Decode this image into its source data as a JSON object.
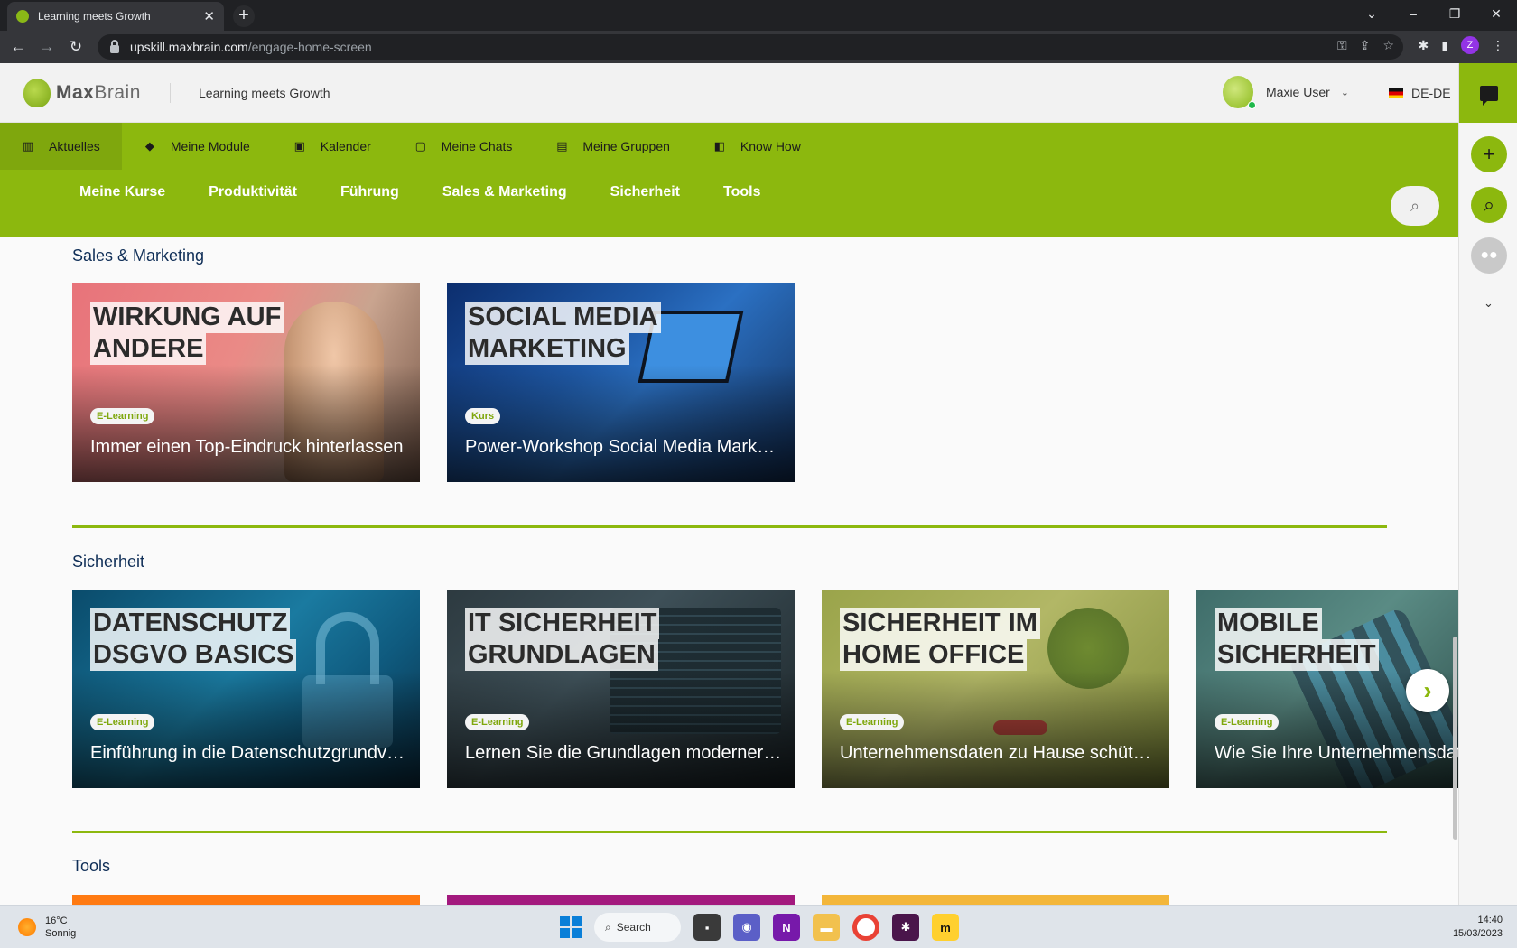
{
  "browser": {
    "tab_title": "Learning meets Growth",
    "new_tab_symbol": "+",
    "url_host": "upskill.maxbrain.com",
    "url_path": "/engage-home-screen",
    "profile_initial": "Z"
  },
  "header": {
    "logo_bold": "Max",
    "logo_light": "Brain",
    "tagline": "Learning meets Growth",
    "user_name": "Maxie User",
    "language": "DE-DE"
  },
  "primary_nav": [
    {
      "label": "Aktuelles",
      "icon": "library-icon"
    },
    {
      "label": "Meine Module",
      "icon": "graduation-cap-icon"
    },
    {
      "label": "Kalender",
      "icon": "calendar-icon"
    },
    {
      "label": "Meine Chats",
      "icon": "chat-square-icon"
    },
    {
      "label": "Meine Gruppen",
      "icon": "group-folder-icon"
    },
    {
      "label": "Know How",
      "icon": "book-open-icon"
    }
  ],
  "secondary_nav": [
    "Meine Kurse",
    "Produktivität",
    "Führung",
    "Sales & Marketing",
    "Sicherheit",
    "Tools"
  ],
  "sections": {
    "sales": {
      "title": "Sales & Marketing",
      "cards": [
        {
          "headline": [
            "WIRKUNG AUF",
            "ANDERE"
          ],
          "badge": "E-Learning",
          "subtitle": "Immer einen Top-Eindruck hinterlassen"
        },
        {
          "headline": [
            "SOCIAL MEDIA",
            "MARKETING"
          ],
          "badge": "Kurs",
          "subtitle": "Power-Workshop Social Media Marketing"
        }
      ]
    },
    "security": {
      "title": "Sicherheit",
      "cards": [
        {
          "headline": [
            "DATENSCHUTZ",
            "DSGVO BASICS"
          ],
          "badge": "E-Learning",
          "subtitle": "Einführung in die Datenschutzgrundverordnung"
        },
        {
          "headline": [
            "IT SICHERHEIT",
            "GRUNDLAGEN"
          ],
          "badge": "E-Learning",
          "subtitle": "Lernen Sie die Grundlagen moderner IT-Sicherheit"
        },
        {
          "headline": [
            "SICHERHEIT IM",
            "HOME OFFICE"
          ],
          "badge": "E-Learning",
          "subtitle": "Unternehmensdaten zu Hause schützen"
        },
        {
          "headline": [
            "MOBILE",
            "SICHERHEIT"
          ],
          "badge": "E-Learning",
          "subtitle": "Wie Sie Ihre Unternehmensdaten"
        }
      ]
    },
    "tools": {
      "title": "Tools"
    }
  },
  "taskbar": {
    "temperature": "16°C",
    "weather": "Sonnig",
    "search_label": "Search",
    "time": "14:40",
    "date": "15/03/2023"
  },
  "colors": {
    "brand_green": "#8cb80e",
    "heading_navy": "#0f2e57"
  }
}
